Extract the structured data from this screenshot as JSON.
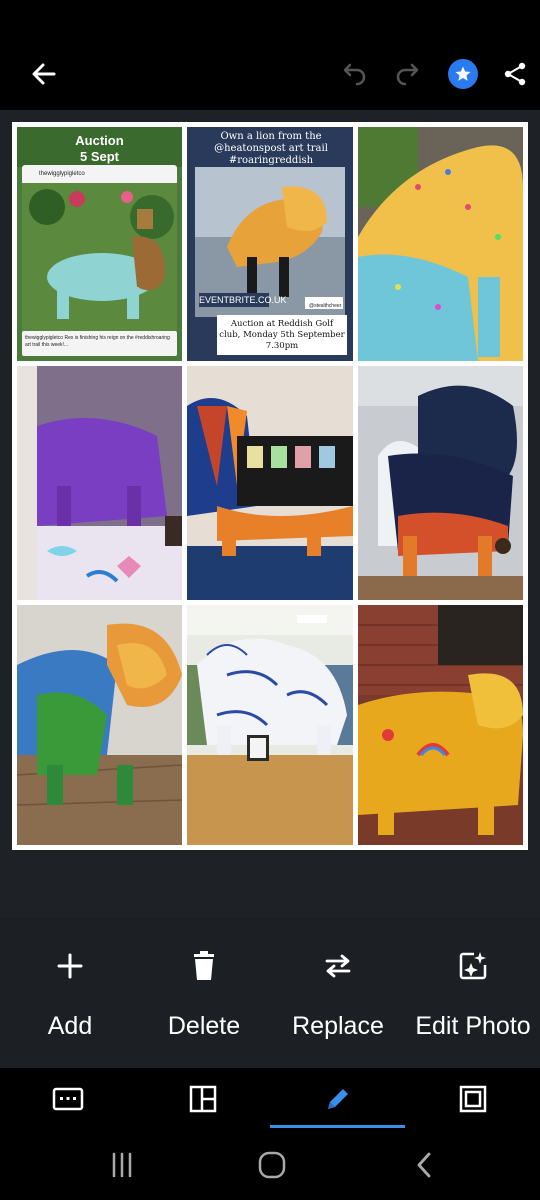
{
  "header": {
    "back_icon": "arrow-left-icon",
    "undo_icon": "undo-icon",
    "redo_icon": "redo-icon",
    "favorite_icon": "star-icon",
    "share_icon": "share-icon",
    "accent": "#2b7bf0"
  },
  "collage": {
    "photos": [
      {
        "title": "Auction",
        "date": "5 Sept",
        "username": "thewigglypigletco",
        "caption": "thewigglypigletco Rex is finishing his reign on the #reddishroaring art trail this week!..."
      },
      {
        "headline": "Own a lion from the @heatonspost art trail #roaringreddish",
        "link": "EVENTBRITE.CO.UK",
        "credit": "@stealthcheer",
        "details": "Auction at Reddish Golf club, Monday 5th September 7.30pm"
      },
      {
        "subject": "lion sculpture with floral pattern"
      },
      {
        "subject": "purple lion sculpture in shop window"
      },
      {
        "subject": "rainbow stripe lion sculpture"
      },
      {
        "subject": "starry night lion sculpture"
      },
      {
        "subject": "golden mane lion sculpture"
      },
      {
        "subject": "blue and white porcelain lion sculpture"
      },
      {
        "subject": "gold lion sculpture with rainbow"
      }
    ]
  },
  "tools": {
    "add": {
      "label": "Add",
      "icon": "plus-icon"
    },
    "delete": {
      "label": "Delete",
      "icon": "trash-icon"
    },
    "replace": {
      "label": "Replace",
      "icon": "swap-arrows-icon"
    },
    "edit_photo": {
      "label": "Edit Photo",
      "icon": "edit-photo-icon"
    }
  },
  "bottom_nav": {
    "items": [
      "keyboard-icon",
      "layout-icon",
      "pencil-icon",
      "border-icon"
    ],
    "active_index": 2,
    "accent": "#3a8fe8"
  },
  "system_nav": {
    "items": [
      "recent-apps-icon",
      "home-icon",
      "back-icon"
    ]
  }
}
